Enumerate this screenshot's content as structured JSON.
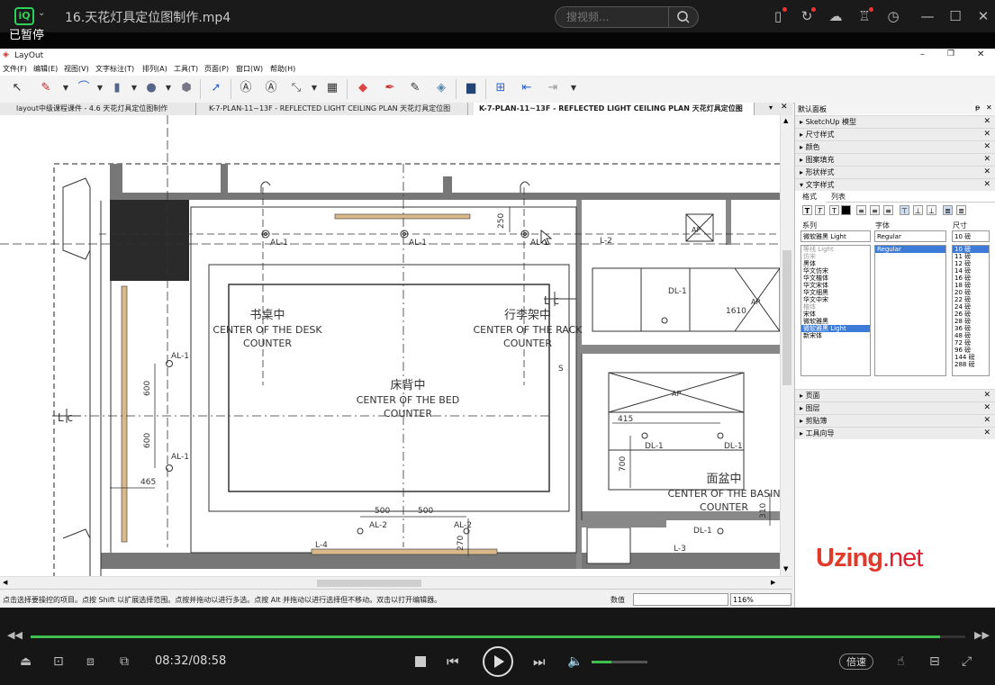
{
  "player": {
    "title": "16.天花灯具定位图制作.mp4",
    "search_placeholder": "搜视频...",
    "paused_label": "已暂停",
    "time": "08:32/08:58",
    "progress": 0.973,
    "volume": 0.35,
    "speed_label": "倍速",
    "accent": "#3fbf4f"
  },
  "app": {
    "title": "LayOut",
    "menu": [
      "文件(F)",
      "编辑(E)",
      "视图(V)",
      "文字标注(T)",
      "排列(A)",
      "工具(T)",
      "页面(P)",
      "窗口(W)",
      "帮助(H)"
    ],
    "tabs": [
      "layout中级课程课件 - 4.6 天花灯具定位图制作",
      "K-7-PLAN-11~13F - REFLECTED LIGHT CEILING PLAN 天花灯具定位图",
      "K-7-PLAN-11~13F - REFLECTED LIGHT CEILING PLAN 天花灯具定位图"
    ],
    "status_text": "点击选择要操控的项目。点按 Shift 以扩展选择范围。点按并拖动以进行多选。点按 Alt 并拖动以进行选择但不移动。双击以打开编辑器。",
    "value_label": "数值",
    "zoom": "116%"
  },
  "drawing": {
    "labels": {
      "desk_cn": "书桌中",
      "desk_en1": "CENTER OF THE DESK",
      "desk_en2": "COUNTER",
      "rack_cn": "行李架中",
      "rack_en1": "CENTER OF THE RACK",
      "rack_en2": "COUNTER",
      "bed_cn": "床背中",
      "bed_en1": "CENTER OF THE BED",
      "bed_en2": "COUNTER",
      "basin_cn": "面盆中",
      "basin_en1": "CENTER OF THE BASIN",
      "basin_en2": "COUNTER"
    },
    "tags": {
      "al1": "AL-1",
      "al2": "AL-2",
      "dl1": "DL-1",
      "l2": "L-2",
      "l3": "L-3",
      "l4": "L-4",
      "ap": "AP",
      "lc": "L c"
    },
    "dims": {
      "d250": "250",
      "d600": "600",
      "d465": "465",
      "d500": "500",
      "d270": "270",
      "d1610": "1610",
      "d415": "415",
      "d700": "700",
      "d310": "310",
      "s": "S"
    }
  },
  "panel": {
    "title": "默认面板",
    "sections_top": [
      "SketchUp 模型",
      "尺寸样式",
      "颜色",
      "图案填充",
      "形状样式",
      "文字样式"
    ],
    "text_tabs": [
      "格式",
      "列表"
    ],
    "col_family": "系列",
    "col_font": "字体",
    "col_size": "尺寸",
    "family_value": "微软雅黑 Light",
    "font_value": "Regular",
    "size_value": "10 磅",
    "families": [
      "等线 Light",
      "仿宋",
      "黑体",
      "华文仿宋",
      "华文楷体",
      "华文宋体",
      "华文细黑",
      "华文中宋",
      "楷体",
      "宋体",
      "微软雅黑",
      "微软雅黑 Light",
      "新宋体"
    ],
    "fonts": [
      "Regular"
    ],
    "sizes": [
      "10 磅",
      "11 磅",
      "12 磅",
      "14 磅",
      "16 磅",
      "18 磅",
      "20 磅",
      "22 磅",
      "24 磅",
      "26 磅",
      "28 磅",
      "36 磅",
      "48 磅",
      "72 磅",
      "96 磅",
      "144 磅",
      "288 磅"
    ],
    "sections_bottom": [
      "页面",
      "图层",
      "剪贴簿",
      "工具向导"
    ]
  },
  "watermark": {
    "brand": "Uzing",
    "tld": ".net"
  }
}
